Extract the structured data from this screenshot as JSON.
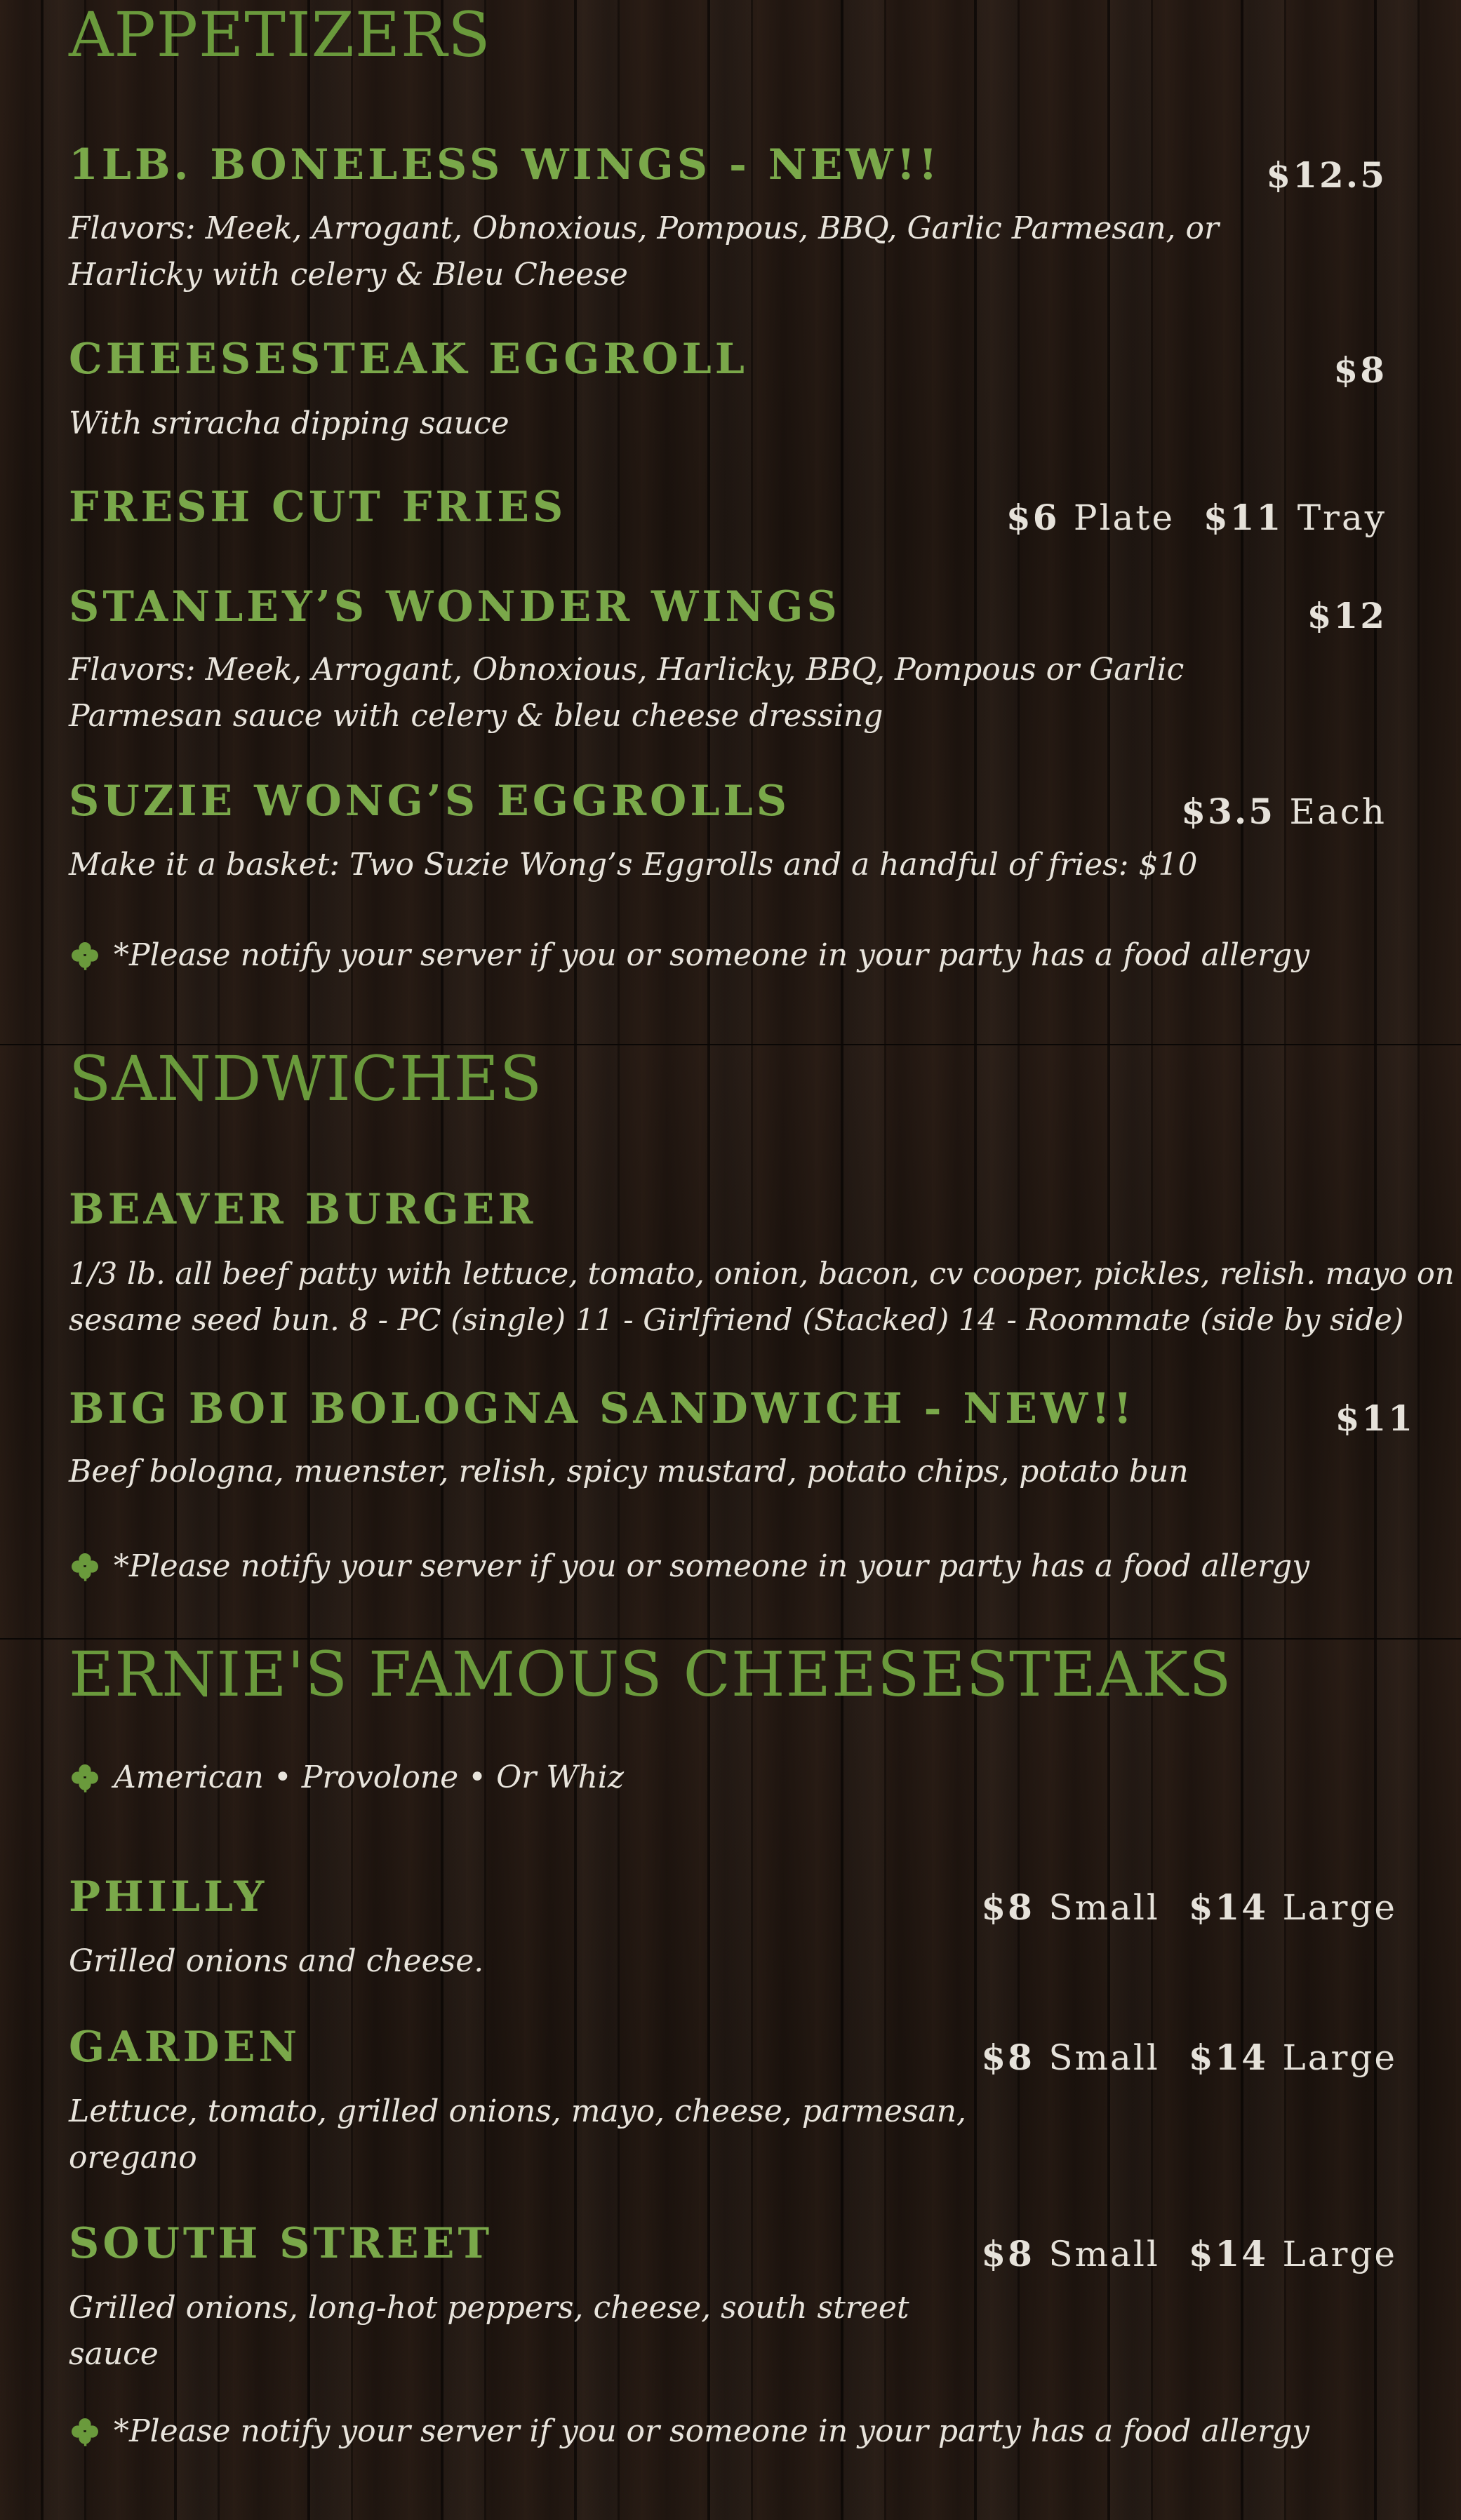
{
  "colors": {
    "title_green": "#6a9a3c",
    "item_green": "#7aa84a",
    "text_light": "#e8e4dc",
    "background_wood": "#1d1410"
  },
  "icons": {
    "bullet": "clover-icon"
  },
  "appetizers": {
    "title": "APPETIZERS",
    "items": [
      {
        "name": "1LB. BONELESS WINGS - NEW!!",
        "price": "$12.5",
        "description": "Flavors: Meek, Arrogant, Obnoxious, Pompous, BBQ, Garlic Parmesan, or Harlicky with celery & Bleu Cheese",
        "desc_lines": [
          "Flavors: Meek, Arrogant, Obnoxious, Pompous, BBQ, Garlic Parmesan, or",
          "Harlicky with celery & Bleu Cheese"
        ]
      },
      {
        "name": "CHEESESTEAK EGGROLL",
        "price": "$8",
        "description": "With sriracha dipping sauce"
      },
      {
        "name": "FRESH CUT FRIES",
        "price_a_amount": "$6",
        "price_a_unit": "Plate",
        "price_b_amount": "$11",
        "price_b_unit": "Tray"
      },
      {
        "name": "STANLEY’S WONDER WINGS",
        "price": "$12",
        "description": "Flavors: Meek, Arrogant, Obnoxious, Harlicky, BBQ, Pompous or Garlic Parmesan sauce with celery & bleu cheese dressing",
        "desc_lines": [
          "Flavors: Meek, Arrogant, Obnoxious, Harlicky, BBQ, Pompous or Garlic",
          "Parmesan sauce with celery & bleu cheese dressing"
        ]
      },
      {
        "name": "SUZIE WONG’S EGGROLLS",
        "price_amount": "$3.5",
        "price_unit": "Each",
        "description": "Make it a basket: Two Suzie Wong’s Eggrolls and a handful of fries: $10"
      }
    ],
    "note": "*Please notify your server if you or someone in your party has a food allergy"
  },
  "sandwiches": {
    "title": "SANDWICHES",
    "items": [
      {
        "name": "BEAVER BURGER",
        "description": "1/3 lb. all beef patty with lettuce, tomato, onion, bacon, cv cooper, pickles, relish. mayo on sesame seed bun. 8 - PC (single) 11 - Girlfriend (Stacked) 14 - Roommate (side by side)",
        "desc_lines": [
          "1/3 lb. all beef patty with lettuce, tomato, onion, bacon, cv cooper, pickles, relish. mayo on",
          "sesame seed bun. 8 - PC (single) 11 - Girlfriend (Stacked) 14 - Roommate (side by side)"
        ]
      },
      {
        "name": "BIG BOI BOLOGNA SANDWICH - NEW!!",
        "price": "$11",
        "description": "Beef bologna, muenster, relish, spicy mustard, potato chips, potato bun"
      }
    ],
    "note": "*Please notify your server if you or someone in your party has a food allergy"
  },
  "cheesesteaks": {
    "title": "ERNIE'S FAMOUS CHEESESTEAKS",
    "options": "American • Provolone • Or Whiz",
    "items": [
      {
        "name": "PHILLY",
        "price_small_amount": "$8",
        "price_small_unit": "Small",
        "price_large_amount": "$14",
        "price_large_unit": "Large",
        "description": "Grilled onions and cheese."
      },
      {
        "name": "GARDEN",
        "price_small_amount": "$8",
        "price_small_unit": "Small",
        "price_large_amount": "$14",
        "price_large_unit": "Large",
        "description": "Lettuce, tomato, grilled onions, mayo, cheese, parmesan, oregano",
        "desc_lines": [
          "Lettuce, tomato, grilled onions, mayo, cheese, parmesan,",
          "oregano"
        ]
      },
      {
        "name": "SOUTH STREET",
        "price_small_amount": "$8",
        "price_small_unit": "Small",
        "price_large_amount": "$14",
        "price_large_unit": "Large",
        "description": "Grilled onions, long-hot peppers, cheese, south street sauce",
        "desc_lines": [
          "Grilled onions, long-hot peppers, cheese, south street",
          "sauce"
        ]
      }
    ],
    "note": "*Please notify your server if you or someone in your party has a food allergy"
  }
}
